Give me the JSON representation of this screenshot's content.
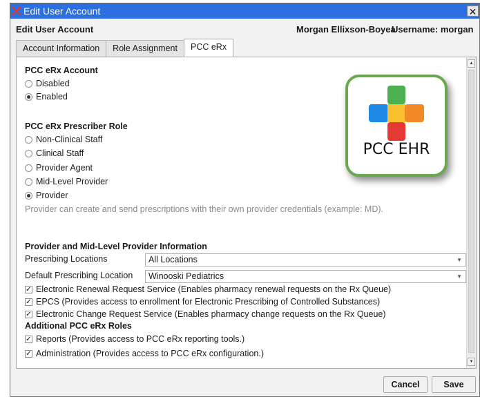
{
  "window": {
    "title": "Edit User Account",
    "close_symbol": "✕"
  },
  "header": {
    "title": "Edit User Account",
    "user_full_name": "Morgan Ellixson-Boyea",
    "username_label": "Username:",
    "username": "morgan"
  },
  "tabs": [
    {
      "label": "Account Information",
      "active": false
    },
    {
      "label": "Role Assignment",
      "active": false
    },
    {
      "label": "PCC eRx",
      "active": true
    }
  ],
  "erx_account": {
    "title": "PCC eRx Account",
    "options": [
      {
        "label": "Disabled",
        "checked": false
      },
      {
        "label": "Enabled",
        "checked": true
      }
    ]
  },
  "prescriber_role": {
    "title": "PCC eRx Prescriber Role",
    "options": [
      {
        "label": "Non-Clinical Staff",
        "checked": false
      },
      {
        "label": "Clinical Staff",
        "checked": false
      },
      {
        "label": "Provider Agent",
        "checked": false
      },
      {
        "label": "Mid-Level Provider",
        "checked": false
      },
      {
        "label": "Provider",
        "checked": true
      }
    ],
    "hint": "Provider can create and send prescriptions with their own provider credentials (example: MD)."
  },
  "provider_info": {
    "title": "Provider and Mid-Level Provider Information",
    "prescribing_locations_label": "Prescribing Locations",
    "prescribing_locations_value": "All Locations",
    "default_location_label": "Default Prescribing Location",
    "default_location_value": "Winooski Pediatrics",
    "checks": [
      {
        "label": "Electronic Renewal Request Service (Enables pharmacy renewal requests on the Rx Queue)",
        "checked": true
      },
      {
        "label": "EPCS  (Provides access to enrollment for Electronic Prescribing of Controlled Substances)",
        "checked": true
      },
      {
        "label": "Electronic Change Request Service (Enables pharmacy change requests on the Rx Queue)",
        "checked": true
      }
    ]
  },
  "additional_roles": {
    "title": "Additional PCC eRx Roles",
    "checks": [
      {
        "label": "Reports  (Provides access to PCC eRx reporting tools.)",
        "checked": true
      },
      {
        "label": "Administration  (Provides access to PCC eRx configuration.)",
        "checked": true
      }
    ]
  },
  "logo": {
    "text": "PCC EHR",
    "colors": {
      "green": "#4caf50",
      "blue": "#1e88e5",
      "yellow": "#fbc02d",
      "orange": "#f08a24",
      "red": "#e53935",
      "border": "#6aa84f"
    }
  },
  "footer": {
    "cancel_label": "Cancel",
    "save_label": "Save"
  },
  "icons": {
    "check_mark": "✓",
    "dropdown_arrow": "▼",
    "scroll_up": "▲",
    "scroll_down": "▼"
  }
}
